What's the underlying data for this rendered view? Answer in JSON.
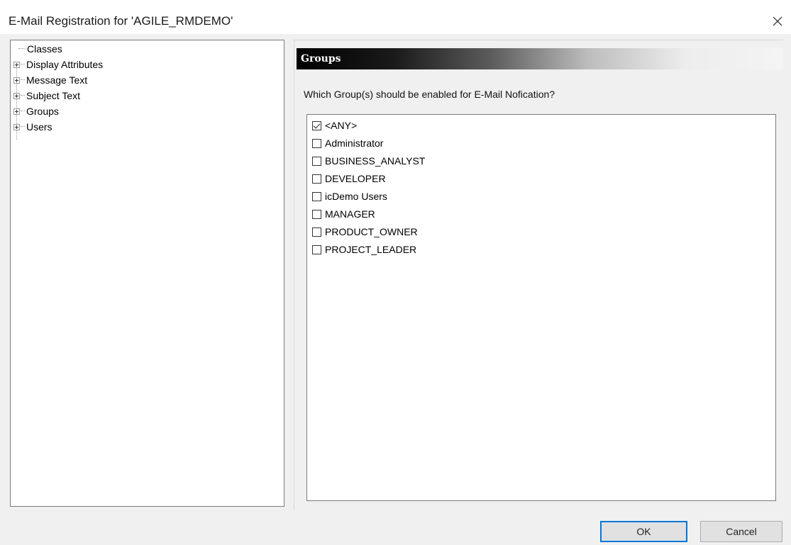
{
  "window": {
    "title": "E-Mail Registration for 'AGILE_RMDEMO'",
    "close_icon": "close-icon"
  },
  "tree": {
    "items": [
      {
        "label": "Classes",
        "expandable": false
      },
      {
        "label": "Display Attributes",
        "expandable": true
      },
      {
        "label": "Message Text",
        "expandable": true
      },
      {
        "label": "Subject Text",
        "expandable": true
      },
      {
        "label": "Groups",
        "expandable": true
      },
      {
        "label": "Users",
        "expandable": true
      }
    ]
  },
  "panel": {
    "header": "Groups",
    "question": "Which Group(s) should be enabled for E-Mail Nofication?"
  },
  "groups": [
    {
      "label": "<ANY>",
      "checked": true
    },
    {
      "label": "Administrator",
      "checked": false
    },
    {
      "label": "BUSINESS_ANALYST",
      "checked": false
    },
    {
      "label": "DEVELOPER",
      "checked": false
    },
    {
      "label": "icDemo Users",
      "checked": false
    },
    {
      "label": "MANAGER",
      "checked": false
    },
    {
      "label": "PRODUCT_OWNER",
      "checked": false
    },
    {
      "label": "PROJECT_LEADER",
      "checked": false
    }
  ],
  "buttons": {
    "ok": "OK",
    "cancel": "Cancel"
  },
  "colors": {
    "default_button_border": "#0078d7",
    "header_gradient_start": "#000000",
    "header_gradient_end": "#f4f4f4"
  }
}
